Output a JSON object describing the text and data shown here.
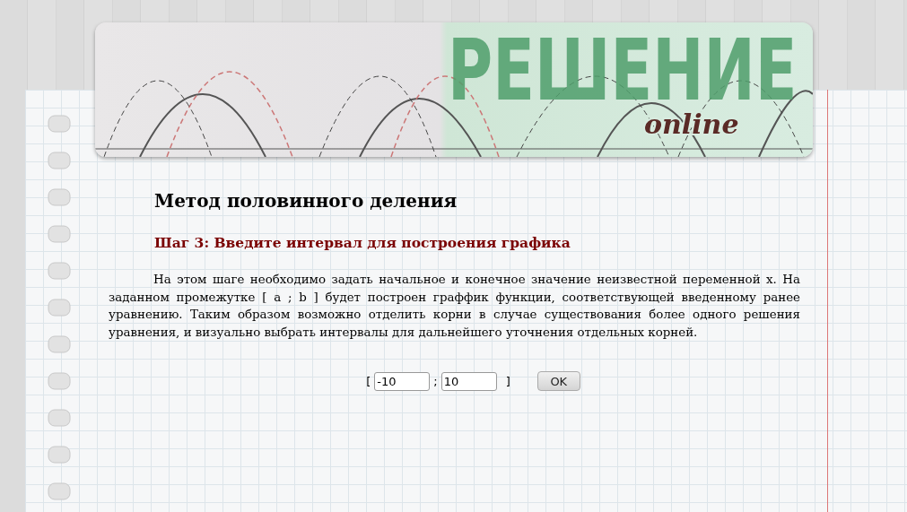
{
  "banner": {
    "logo": "РЕШЕНИЕ",
    "logo_sub": "online"
  },
  "title": "Метод половинного деления",
  "step_title": "Шаг 3: Введите интервал для построения графика",
  "description": "На этом шаге необходимо задать начальное и конечное значение неизвестной переменной x. На заданном промежутке [ a ; b ] будет построен граффик функции, соответствующей введенному ранее уравнению. Таким образом возможно отделить корни в случае существования более одного решения уравнения, и визуально выбрать интервалы для дальнейшего уточнения отдельных корней.",
  "interval_form": {
    "open_bracket": "[",
    "start": {
      "value": "-10"
    },
    "separator": ";",
    "end": {
      "value": "10"
    },
    "close_bracket": "]",
    "submit": "OK"
  }
}
